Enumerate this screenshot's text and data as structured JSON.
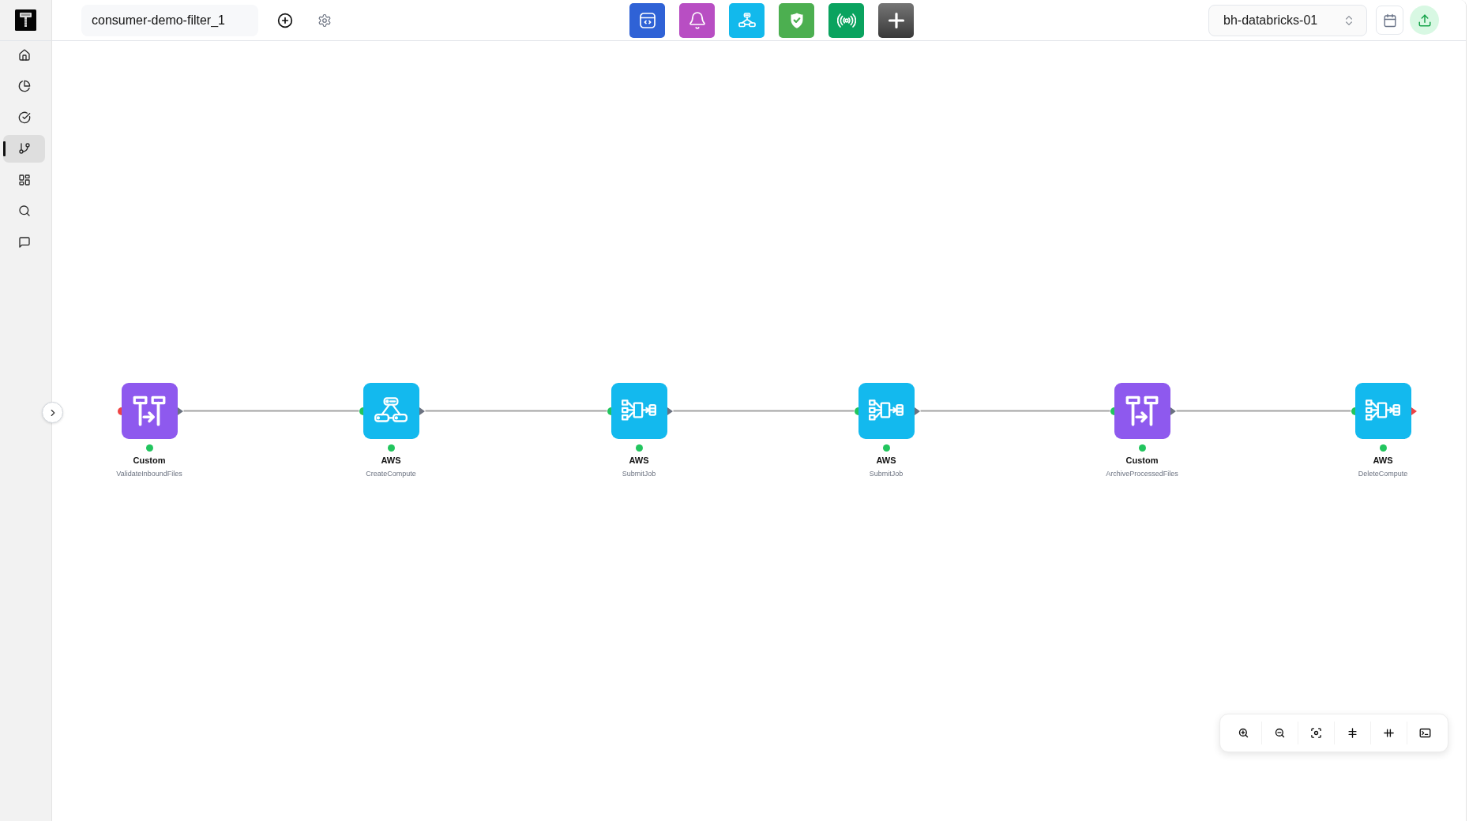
{
  "sidebar": {
    "items": [
      {
        "kind": "home",
        "selected": false
      },
      {
        "kind": "chart",
        "selected": false
      },
      {
        "kind": "check",
        "selected": false
      },
      {
        "kind": "branch",
        "selected": true
      },
      {
        "kind": "grid",
        "selected": false
      },
      {
        "kind": "search",
        "selected": false
      },
      {
        "kind": "chat",
        "selected": false
      }
    ]
  },
  "header": {
    "pipeline_name": {
      "value": "consumer-demo-filter_1"
    },
    "toolbar": [
      {
        "kind": "code",
        "color": "#2f62d6"
      },
      {
        "kind": "bell",
        "color": "#b84ec3"
      },
      {
        "kind": "network",
        "color": "#12b9ec"
      },
      {
        "kind": "shield",
        "color": "#4caf50"
      },
      {
        "kind": "broadcast",
        "color": "#0aa35f"
      },
      {
        "kind": "add",
        "color": "#575757"
      }
    ],
    "environment_select": {
      "value": "bh-databricks-01"
    }
  },
  "canvas": {
    "nodes": [
      {
        "kind": "transform",
        "provider": "Custom",
        "name": "ValidateInboundFiles",
        "status": {
          "color": "#22c55e"
        },
        "input_handle": {
          "color": "#ef4444"
        },
        "output_handle": {
          "color": "#6b7280"
        }
      },
      {
        "kind": "cluster",
        "provider": "AWS",
        "name": "CreateCompute",
        "status": {
          "color": "#22c55e"
        },
        "input_handle": {
          "color": "#22c55e"
        },
        "output_handle": {
          "color": "#6b7280"
        }
      },
      {
        "kind": "flow",
        "provider": "AWS",
        "name": "SubmitJob",
        "status": {
          "color": "#22c55e"
        },
        "input_handle": {
          "color": "#22c55e"
        },
        "output_handle": {
          "color": "#6b7280"
        }
      },
      {
        "kind": "flow",
        "provider": "AWS",
        "name": "SubmitJob",
        "status": {
          "color": "#22c55e"
        },
        "input_handle": {
          "color": "#22c55e"
        },
        "output_handle": {
          "color": "#6b7280"
        }
      },
      {
        "kind": "transform",
        "provider": "Custom",
        "name": "ArchiveProcessedFiles",
        "status": {
          "color": "#22c55e"
        },
        "input_handle": {
          "color": "#22c55e"
        },
        "output_handle": {
          "color": "#6b7280"
        }
      },
      {
        "kind": "flow",
        "provider": "AWS",
        "name": "DeleteCompute",
        "status": {
          "color": "#22c55e"
        },
        "input_handle": {
          "color": "#22c55e"
        },
        "output_handle": {
          "color": "#ef4444"
        }
      }
    ]
  }
}
